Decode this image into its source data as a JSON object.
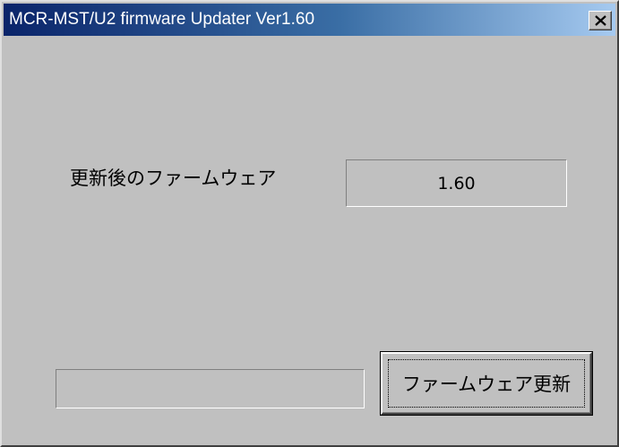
{
  "window": {
    "title": "MCR-MST/U2 firmware Updater Ver1.60",
    "close_icon": "close-icon"
  },
  "firmware": {
    "label": "更新後のファームウェア",
    "version": "1.60"
  },
  "progress": {
    "value": 0
  },
  "actions": {
    "update_button_label": "ファームウェア更新"
  }
}
